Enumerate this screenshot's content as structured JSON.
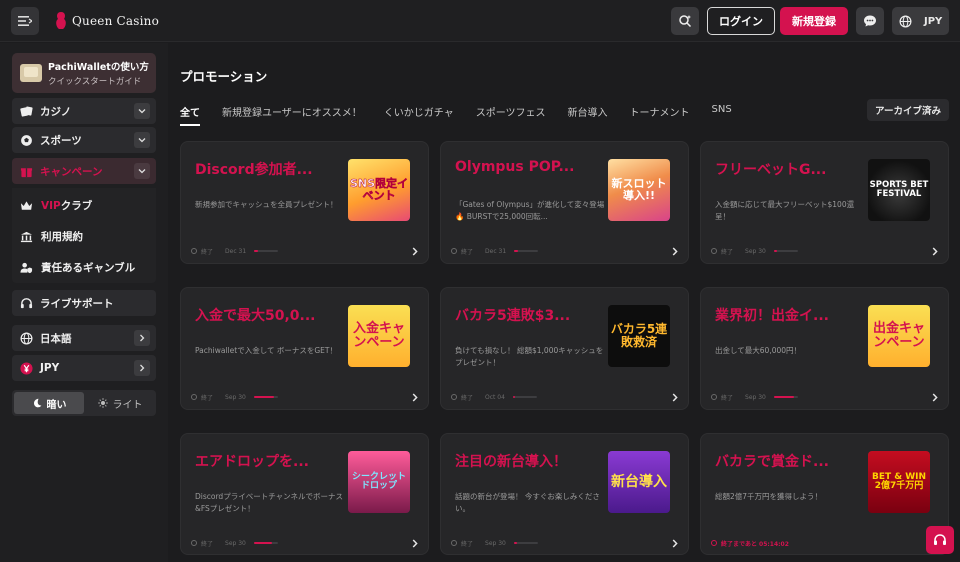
{
  "header": {
    "logo_text": "Queen Casino",
    "login_label": "ログイン",
    "register_label": "新規登録",
    "currency": "JPY",
    "icons": [
      "menu-icon",
      "search-icon",
      "chat-icon",
      "globe-icon"
    ]
  },
  "sidebar": {
    "wallet": {
      "title": "PachiWalletの使い方",
      "subtitle": "クイックスタートガイド"
    },
    "items": [
      {
        "label": "カジノ",
        "icon": "cards-icon",
        "chevron": "down"
      },
      {
        "label": "スポーツ",
        "icon": "ball-icon",
        "chevron": "down"
      },
      {
        "label": "キャンペーン",
        "icon": "gift-icon",
        "chevron": "down",
        "active": true
      },
      {
        "label": "ライブサポート",
        "icon": "headset-icon"
      },
      {
        "label": "日本語",
        "icon": "globe-icon",
        "chevron": "right"
      },
      {
        "label": "JPY",
        "icon": "yen-icon",
        "chevron": "right"
      }
    ],
    "sub_items": [
      {
        "vip": "VIP",
        "label": "クラブ",
        "icon": "crown-icon"
      },
      {
        "label": "利用規約",
        "icon": "bank-icon"
      },
      {
        "label": "責任あるギャンブル",
        "icon": "user-shield-icon"
      }
    ],
    "theme": {
      "dark_label": "暗い",
      "light_label": "ライト"
    }
  },
  "main": {
    "title": "プロモーション",
    "archive_label": "アーカイブ済み",
    "tabs": [
      "全て",
      "新規登録ユーザーにオススメ！",
      "くいかじガチャ",
      "スポーツフェス",
      "新台導入",
      "トーナメント",
      "SNS"
    ],
    "cards": [
      {
        "title": "Discord参加者...",
        "desc": "新規参加でキャッシュを全員プレゼント！",
        "end": "Dec 31",
        "progress": 0.15,
        "thumb": "SNS限定イベント",
        "thumb_class": "t-sns"
      },
      {
        "title": "Olympus POP...",
        "desc": "「Gates of Olympus」が進化して変々登場🔥 BURSTで25,000回転...",
        "end": "Dec 31",
        "progress": 0.15,
        "thumb": "新スロット導入!!",
        "thumb_class": "t-slot"
      },
      {
        "title": "フリーベットG...",
        "desc": "入金額に応じて最大フリーベット$100還呈！",
        "end": "Sep 30",
        "progress": 0.15,
        "thumb": "SPORTS BET FESTIVAL",
        "thumb_class": "t-fest"
      },
      {
        "title": "入金で最大50,0...",
        "desc": "Pachiwalletで入金して ボーナスをGET！",
        "end": "Sep 30",
        "progress": 0.85,
        "thumb": "入金キャンペーン",
        "thumb_class": "t-deposit"
      },
      {
        "title": "バカラ5連敗$3...",
        "desc": "負けても損なし！ 総額$1,000キャッシュをプレゼント！",
        "end": "Oct 04",
        "progress": 0.1,
        "thumb": "バカラ5連敗救済",
        "thumb_class": "t-baccarat"
      },
      {
        "title": "業界初！出金イ...",
        "desc": "出金して最大60,000円！",
        "end": "Sep 30",
        "progress": 0.85,
        "thumb": "出金キャンペーン",
        "thumb_class": "t-deposit"
      },
      {
        "title": "エアドロップを...",
        "desc": "Discordプライベートチャンネルでボーナス&FSプレゼント！",
        "end": "Sep 30",
        "progress": 0.75,
        "thumb": "シークレットドロップ",
        "thumb_class": "t-airdrop"
      },
      {
        "title": "注目の新台導入！",
        "desc": "話題の新台が登場！ 今すぐお楽しみください。",
        "end": "Sep 30",
        "progress": 0.15,
        "thumb": "新台導入",
        "thumb_class": "t-newgame"
      },
      {
        "title": "バカラで賞金ド...",
        "desc": "総額2億7千万円を獲得しよう！",
        "end": "",
        "countdown": "終了まであと 05:14:02",
        "progress": 0,
        "thumb": "BET & WIN 2億7千万円",
        "thumb_class": "t-betwin"
      }
    ],
    "end_label": "終了"
  }
}
